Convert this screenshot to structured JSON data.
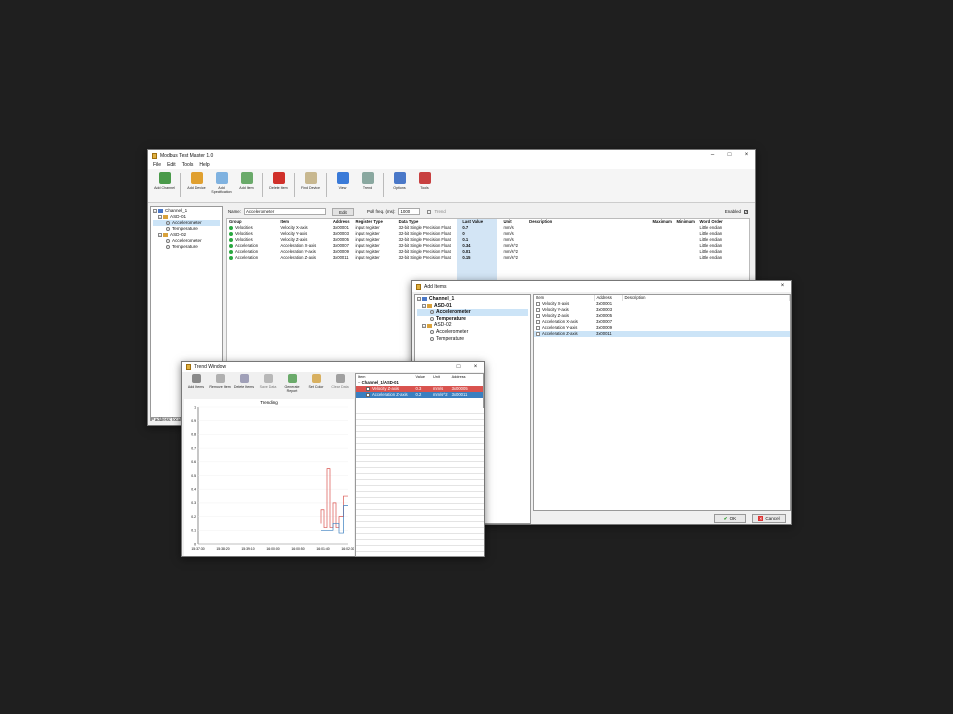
{
  "main": {
    "title": "Modbus Test Master 1.0",
    "menu": [
      "File",
      "Edit",
      "Tools",
      "Help"
    ],
    "toolbar": [
      {
        "label": "Add Channel",
        "icon": "channel-icon",
        "color": "#4a9a4a"
      },
      {
        "label": "Add Device",
        "icon": "device-icon",
        "color": "#e0a030"
      },
      {
        "label": "Add Specification",
        "icon": "spec-icon",
        "color": "#7fb2e0"
      },
      {
        "label": "Add Item",
        "icon": "item-icon",
        "color": "#6aaa6a"
      },
      {
        "label": "Delete Item",
        "icon": "delete-icon",
        "color": "#d0302a"
      },
      {
        "label": "Find Device",
        "icon": "find-icon",
        "color": "#c8b890"
      },
      {
        "label": "View",
        "icon": "view-icon",
        "color": "#3a7ad8"
      },
      {
        "label": "Trend",
        "icon": "trend-icon",
        "color": "#8aa8a0"
      },
      {
        "label": "Options",
        "icon": "options-icon",
        "color": "#4a78c8"
      },
      {
        "label": "Tools",
        "icon": "tools-icon",
        "color": "#c84040"
      }
    ],
    "tree": {
      "channel": "Channel_1",
      "device1": "ASD-01",
      "dev1_items": [
        "Accelerometer",
        "Temperature"
      ],
      "device2": "ASD-02",
      "dev2_items": [
        "Accelerometer",
        "Temperature"
      ]
    },
    "status": "IP address: local",
    "props": {
      "name_label": "Name:",
      "name_value": "Accelerometer",
      "edit": "Edit",
      "poll_label": "Poll freq. (ms):",
      "poll_value": "1000",
      "trend_label": "Trend",
      "enabled_label": "Enabled"
    },
    "columns": [
      "Group",
      "Item",
      "Address",
      "Register Type",
      "Data Type",
      "Last Value",
      "Unit",
      "Description",
      "Maximum",
      "Minimum",
      "Word Order"
    ],
    "rows": [
      [
        "Velocities",
        "Velocity X-axis",
        "3x00001",
        "input register",
        "32-bit Single Precision Float",
        "0.7",
        "mm/s",
        "",
        "",
        "",
        "Little endian"
      ],
      [
        "Velocities",
        "Velocity Y-axis",
        "3x00003",
        "input register",
        "32-bit Single Precision Float",
        "0",
        "mm/s",
        "",
        "",
        "",
        "Little endian"
      ],
      [
        "Velocities",
        "Velocity Z-axis",
        "3x00005",
        "input register",
        "32-bit Single Precision Float",
        "0.1",
        "mm/s",
        "",
        "",
        "",
        "Little endian"
      ],
      [
        "Acceleration",
        "Acceleration X-axis",
        "3x00007",
        "input register",
        "32-bit Single Precision Float",
        "0.34",
        "mm/s^2",
        "",
        "",
        "",
        "Little endian"
      ],
      [
        "Acceleration",
        "Acceleration Y-axis",
        "3x00009",
        "input register",
        "32-bit Single Precision Float",
        "0.01",
        "mm/s^2",
        "",
        "",
        "",
        "Little endian"
      ],
      [
        "Acceleration",
        "Acceleration Z-axis",
        "3x00011",
        "input register",
        "32-bit Single Precision Float",
        "0.15",
        "mm/s^2",
        "",
        "",
        "",
        "Little endian"
      ]
    ]
  },
  "add_items": {
    "title": "Add Items",
    "tree": {
      "channel": "Channel_1",
      "device1": "ASD-01",
      "dev1_items": [
        "Accelerometer",
        "Temperature"
      ],
      "device2": "ASD-02",
      "dev2_items": [
        "Accelerometer",
        "Temperature"
      ]
    },
    "columns": [
      "Item",
      "Address",
      "Description"
    ],
    "items": [
      {
        "name": "Velocity X-axis",
        "address": "3x00001"
      },
      {
        "name": "Velocity Y-axis",
        "address": "3x00003"
      },
      {
        "name": "Velocity Z-axis",
        "address": "3x00005"
      },
      {
        "name": "Acceleration X-axis",
        "address": "3x00007"
      },
      {
        "name": "Acceleration Y-axis",
        "address": "3x00009"
      },
      {
        "name": "Acceleration Z-axis",
        "address": "3x00011"
      }
    ],
    "ok": "OK",
    "cancel": "Cancel"
  },
  "trend": {
    "title": "Trend Window",
    "toolbar": [
      "Add Items",
      "Remove Item",
      "Delete Items",
      "Save Data",
      "Generate Report",
      "Set Color",
      "Clear Data"
    ],
    "chart_title": "Trending",
    "columns": [
      "Item",
      "Value",
      "Unit",
      "Address"
    ],
    "group": "Channel_1/ASD-01",
    "items": [
      {
        "name": "Velocity Z-axis",
        "value": "0.3",
        "unit": "mm/s",
        "address": "3x00005",
        "color": "#d9534f"
      },
      {
        "name": "Acceleration Z-axis",
        "value": "0.2",
        "unit": "mm/s^2",
        "address": "3x00011",
        "color": "#3a7fc0"
      }
    ]
  },
  "chart_data": {
    "type": "line",
    "title": "Trending",
    "y_ticks": [
      "1",
      "0.9",
      "0.8",
      "0.7",
      "0.6",
      "0.5",
      "0.4",
      "0.3",
      "0.2",
      "0.1",
      "0"
    ],
    "x_ticks": [
      "15:37:30",
      "15:38:20",
      "15:39:10",
      "16:00:00",
      "16:00:50",
      "16:01:40",
      "16:02:30"
    ],
    "ylim": [
      0,
      1
    ],
    "series": [
      {
        "name": "Velocity Z-axis",
        "color": "#d9534f",
        "x": [
          0,
          0.82,
          0.82,
          0.84,
          0.84,
          0.86,
          0.86,
          0.88,
          0.88,
          0.9,
          0.9,
          0.92,
          0.92,
          0.94,
          0.94,
          0.97,
          0.97,
          1
        ],
        "y": [
          0,
          0.15,
          0.25,
          0.25,
          0.12,
          0.12,
          0.55,
          0.55,
          0.12,
          0.12,
          0.3,
          0.3,
          0.12,
          0.12,
          0.2,
          0.2,
          0.35,
          0.35
        ]
      },
      {
        "name": "Acceleration Z-axis",
        "color": "#3a7fc0",
        "x": [
          0,
          0.82,
          0.88,
          0.9,
          0.9,
          0.94,
          0.94,
          0.97,
          0.97,
          1
        ],
        "y": [
          0,
          0.1,
          0.1,
          0.1,
          0.15,
          0.15,
          0.08,
          0.08,
          0.28,
          0.28
        ]
      }
    ]
  }
}
